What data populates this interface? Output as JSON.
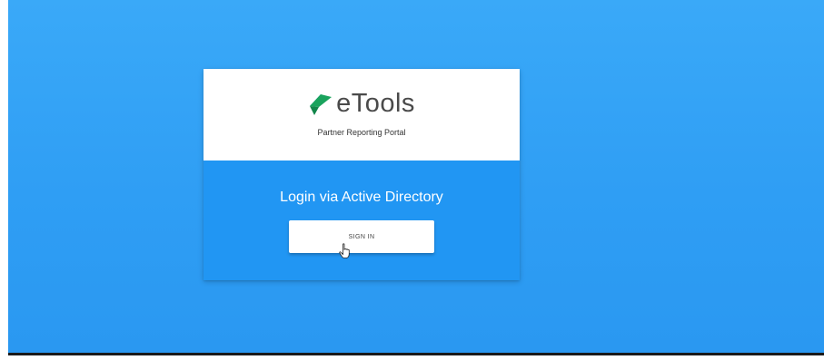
{
  "brand": {
    "name": "eTools",
    "subtitle": "Partner Reporting Portal",
    "logo_icon": "etools-leaf-logo",
    "logo_colors": [
      "#1aa35d",
      "#19a0d8"
    ]
  },
  "login": {
    "title": "Login via Active Directory",
    "button_label": "SIGN IN"
  },
  "colors": {
    "background": "#36a6f7",
    "panel": "#2196f3",
    "header": "#ffffff"
  },
  "cursor_icon": "pointer-cursor-icon"
}
